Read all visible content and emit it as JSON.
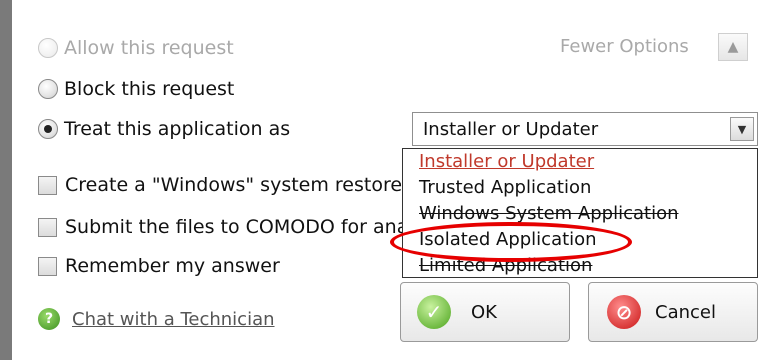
{
  "options": {
    "allow_label": "Allow this request",
    "block_label": "Block this request",
    "treat_label": "Treat this application as"
  },
  "fewer_options": {
    "label": "Fewer Options",
    "icon": "chevron-up-icon"
  },
  "select": {
    "value": "Installer or Updater"
  },
  "dropdown": {
    "items": [
      "Installer or Updater",
      "Trusted Application",
      "Windows System Application",
      "Isolated Application",
      "Limited Application"
    ]
  },
  "checkboxes": {
    "restore_label": "Create a \"Windows\" system restore",
    "submit_label": "Submit the files to COMODO for ana",
    "remember_label": "Remember my answer"
  },
  "chat": {
    "label": "Chat with a Technician"
  },
  "buttons": {
    "ok_label": "OK",
    "cancel_label": "Cancel"
  },
  "colors": {
    "highlight": "#e60000",
    "selected_item": "#c0392b"
  }
}
